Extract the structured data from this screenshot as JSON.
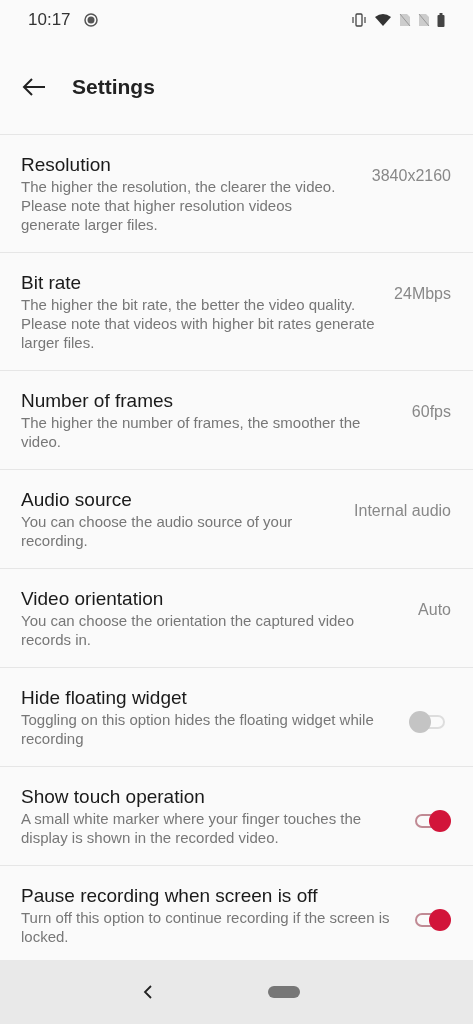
{
  "status_bar": {
    "time": "10:17"
  },
  "header": {
    "title": "Settings"
  },
  "settings": [
    {
      "kind": "value",
      "title": "Resolution",
      "description": "The higher the resolution, the clearer the video. Please note that higher resolution videos generate larger files.",
      "value": "3840x2160"
    },
    {
      "kind": "value",
      "title": "Bit rate",
      "description": "The higher the bit rate, the better the video quality. Please note that videos with higher bit rates generate larger files.",
      "value": "24Mbps"
    },
    {
      "kind": "value",
      "title": "Number of frames",
      "description": "The higher the number of frames, the smoother the video.",
      "value": "60fps"
    },
    {
      "kind": "value",
      "title": "Audio source",
      "description": "You can choose the audio source of your recording.",
      "value": "Internal audio"
    },
    {
      "kind": "value",
      "title": "Video orientation",
      "description": "You can choose the orientation the captured video records in.",
      "value": "Auto"
    },
    {
      "kind": "toggle",
      "title": "Hide floating widget",
      "description": "Toggling on this option hides the floating widget while recording",
      "on": false
    },
    {
      "kind": "toggle",
      "title": "Show touch operation",
      "description": "A small white marker where your finger touches the display is shown in the recorded video.",
      "on": true
    },
    {
      "kind": "toggle",
      "title": "Pause recording when screen is off",
      "description": "Turn off this option to continue recording if the screen is locked.",
      "on": true
    }
  ]
}
